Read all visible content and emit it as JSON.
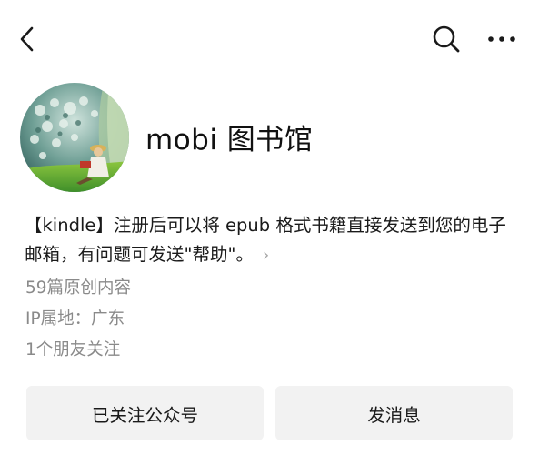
{
  "header": {
    "back_icon": "chevron-left-icon",
    "search_icon": "search-icon",
    "more_icon": "more-dots-icon"
  },
  "profile": {
    "avatar": "avatar-painting",
    "name": "mobi 图书馆",
    "intro_text": "【kindle】注册后可以将 epub 格式书籍直接发送到您的电子邮箱，有问题可发送\"帮助\"。",
    "intro_chevron": "›",
    "articles_count": "59篇原创内容",
    "ip_location": "IP属地：广东",
    "friends_following": "1个朋友关注"
  },
  "actions": {
    "followed_label": "已关注公众号",
    "message_label": "发消息"
  },
  "colors": {
    "meta_text": "#8a8a8a",
    "button_bg": "#f2f2f2"
  }
}
